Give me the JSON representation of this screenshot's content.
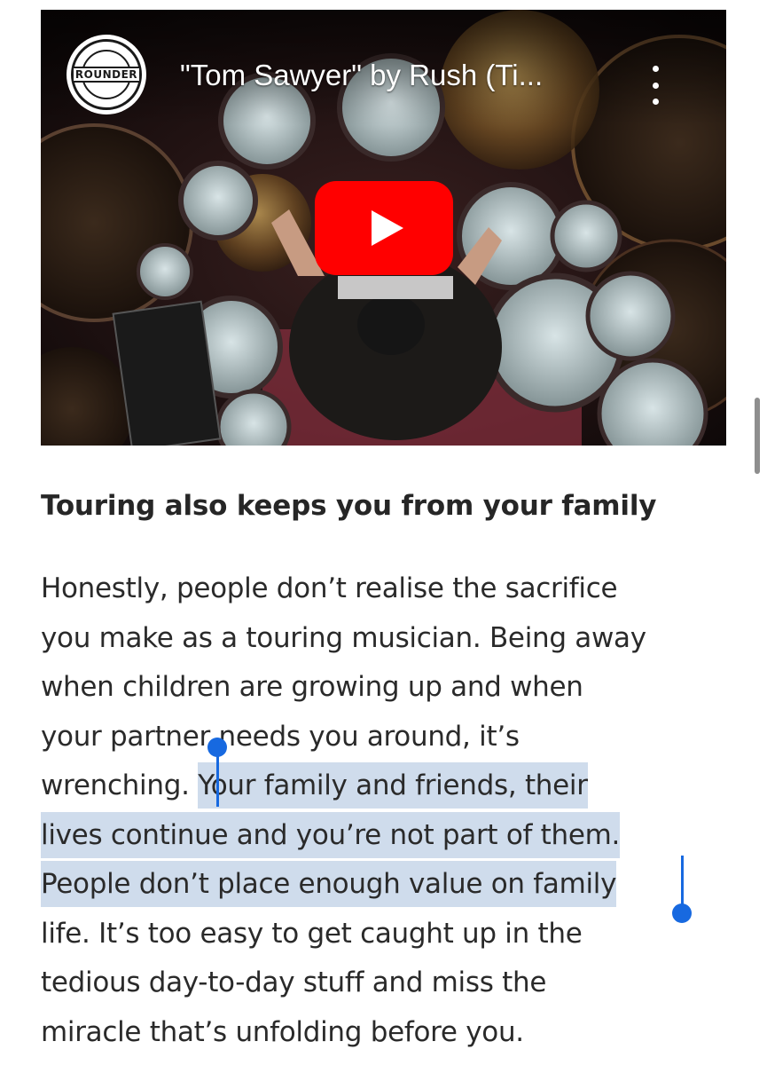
{
  "video": {
    "channel_logo_text": "ROUNDER",
    "title": "\"Tom Sawyer\" by Rush (Ti...",
    "more_icon": "vertical-dots-icon",
    "play_icon": "play-icon",
    "play_color": "#ff0000"
  },
  "article": {
    "heading": "Touring also keeps you from your family",
    "lines": [
      "Honestly, people don’t realise the sacrifice",
      "you make as a touring musician. Being away",
      "when children are growing up and when",
      "your partner needs you around, it’s",
      "life. It’s too easy to get caught up in the",
      "tedious day-to-day stuff and miss the",
      "miracle that’s unfolding before you."
    ],
    "line5_before": "wrenching. ",
    "selection": {
      "part1": "Your family and friends, their",
      "part2": "lives continue and you’re not part of them.",
      "part3": "People don’t place enough value on family"
    },
    "selection_color": "#cfdcec",
    "handle_color": "#1769e0"
  }
}
